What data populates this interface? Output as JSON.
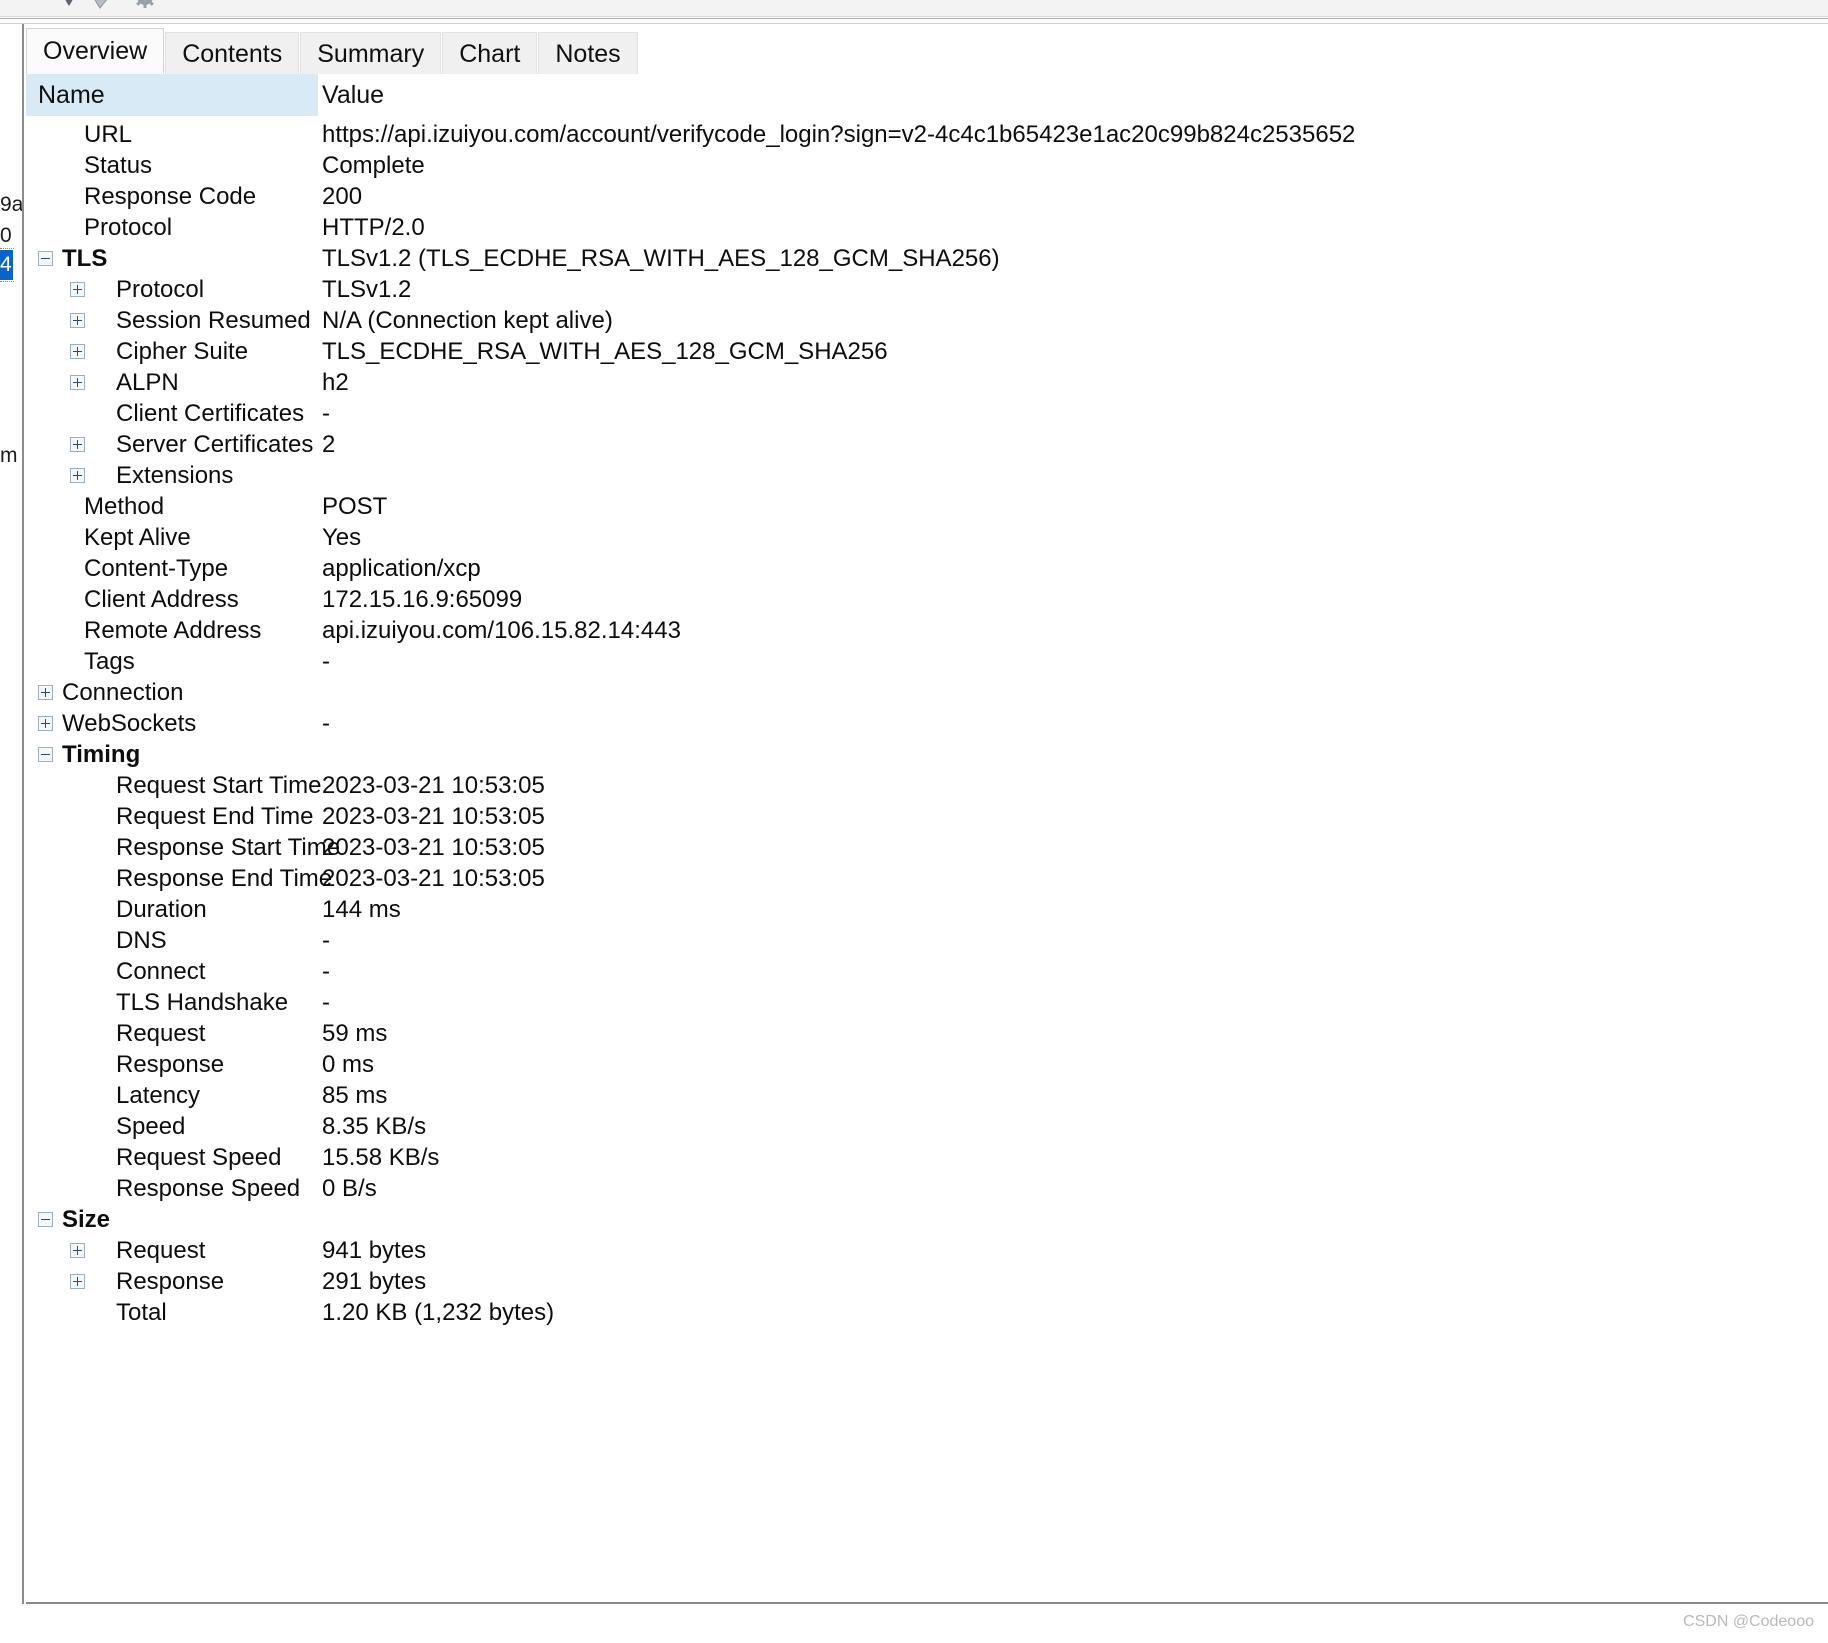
{
  "toolbar": {
    "icons": [
      "pin-icon",
      "tag-icon",
      "gear-icon"
    ]
  },
  "left_gutter": {
    "fragment_1": "9a",
    "fragment_2": "0",
    "selected_fragment": "4",
    "fragment_3": "m"
  },
  "tabs": [
    {
      "label": "Overview",
      "active": true
    },
    {
      "label": "Contents",
      "active": false
    },
    {
      "label": "Summary",
      "active": false
    },
    {
      "label": "Chart",
      "active": false
    },
    {
      "label": "Notes",
      "active": false
    }
  ],
  "grid": {
    "columns": [
      "Name",
      "Value"
    ],
    "rows": [
      {
        "name": "URL",
        "value": "https://api.izuiyou.com/account/verifycode_login?sign=v2-4c4c1b65423e1ac20c99b824c2535652",
        "indent": 1,
        "expander": "none",
        "bold": false
      },
      {
        "name": "Status",
        "value": "Complete",
        "indent": 1,
        "expander": "none",
        "bold": false
      },
      {
        "name": "Response Code",
        "value": "200",
        "indent": 1,
        "expander": "none",
        "bold": false
      },
      {
        "name": "Protocol",
        "value": "HTTP/2.0",
        "indent": 1,
        "expander": "none",
        "bold": false
      },
      {
        "name": "TLS",
        "value": "TLSv1.2 (TLS_ECDHE_RSA_WITH_AES_128_GCM_SHA256)",
        "indent": 0,
        "expander": "minus-l0",
        "bold": true
      },
      {
        "name": "Protocol",
        "value": "TLSv1.2",
        "indent": 2,
        "expander": "plus-l1",
        "bold": false
      },
      {
        "name": "Session Resumed",
        "value": "N/A (Connection kept alive)",
        "indent": 2,
        "expander": "plus-l1",
        "bold": false
      },
      {
        "name": "Cipher Suite",
        "value": "TLS_ECDHE_RSA_WITH_AES_128_GCM_SHA256",
        "indent": 2,
        "expander": "plus-l1",
        "bold": false
      },
      {
        "name": "ALPN",
        "value": "h2",
        "indent": 2,
        "expander": "plus-l1",
        "bold": false
      },
      {
        "name": "Client Certificates",
        "value": "-",
        "indent": 2,
        "expander": "none",
        "bold": false
      },
      {
        "name": "Server Certificates",
        "value": "2",
        "indent": 2,
        "expander": "plus-l1",
        "bold": false
      },
      {
        "name": "Extensions",
        "value": "",
        "indent": 2,
        "expander": "plus-l1",
        "bold": false
      },
      {
        "name": "Method",
        "value": "POST",
        "indent": 1,
        "expander": "none",
        "bold": false
      },
      {
        "name": "Kept Alive",
        "value": "Yes",
        "indent": 1,
        "expander": "none",
        "bold": false
      },
      {
        "name": "Content-Type",
        "value": "application/xcp",
        "indent": 1,
        "expander": "none",
        "bold": false
      },
      {
        "name": "Client Address",
        "value": "172.15.16.9:65099",
        "indent": 1,
        "expander": "none",
        "bold": false
      },
      {
        "name": "Remote Address",
        "value": "api.izuiyou.com/106.15.82.14:443",
        "indent": 1,
        "expander": "none",
        "bold": false
      },
      {
        "name": "Tags",
        "value": "-",
        "indent": 1,
        "expander": "none",
        "bold": false
      },
      {
        "name": "Connection",
        "value": "",
        "indent": 0,
        "expander": "plus-l0",
        "bold": false
      },
      {
        "name": "WebSockets",
        "value": "-",
        "indent": 0,
        "expander": "plus-l0",
        "bold": false
      },
      {
        "name": "Timing",
        "value": "",
        "indent": 0,
        "expander": "minus-l0",
        "bold": true
      },
      {
        "name": "Request Start Time",
        "value": "2023-03-21 10:53:05",
        "indent": 2,
        "expander": "none",
        "bold": false
      },
      {
        "name": "Request End Time",
        "value": "2023-03-21 10:53:05",
        "indent": 2,
        "expander": "none",
        "bold": false
      },
      {
        "name": "Response Start Time",
        "value": "2023-03-21 10:53:05",
        "indent": 2,
        "expander": "none",
        "bold": false
      },
      {
        "name": "Response End Time",
        "value": "2023-03-21 10:53:05",
        "indent": 2,
        "expander": "none",
        "bold": false
      },
      {
        "name": "Duration",
        "value": "144 ms",
        "indent": 2,
        "expander": "none",
        "bold": false
      },
      {
        "name": "DNS",
        "value": "-",
        "indent": 2,
        "expander": "none",
        "bold": false
      },
      {
        "name": "Connect",
        "value": "-",
        "indent": 2,
        "expander": "none",
        "bold": false
      },
      {
        "name": "TLS Handshake",
        "value": "-",
        "indent": 2,
        "expander": "none",
        "bold": false
      },
      {
        "name": "Request",
        "value": "59 ms",
        "indent": 2,
        "expander": "none",
        "bold": false
      },
      {
        "name": "Response",
        "value": "0 ms",
        "indent": 2,
        "expander": "none",
        "bold": false
      },
      {
        "name": "Latency",
        "value": "85 ms",
        "indent": 2,
        "expander": "none",
        "bold": false
      },
      {
        "name": "Speed",
        "value": "8.35 KB/s",
        "indent": 2,
        "expander": "none",
        "bold": false
      },
      {
        "name": "Request Speed",
        "value": "15.58 KB/s",
        "indent": 2,
        "expander": "none",
        "bold": false
      },
      {
        "name": "Response Speed",
        "value": "0 B/s",
        "indent": 2,
        "expander": "none",
        "bold": false
      },
      {
        "name": "Size",
        "value": "",
        "indent": 0,
        "expander": "minus-l0",
        "bold": true
      },
      {
        "name": "Request",
        "value": "941 bytes",
        "indent": 2,
        "expander": "plus-l1",
        "bold": false
      },
      {
        "name": "Response",
        "value": "291 bytes",
        "indent": 2,
        "expander": "plus-l1",
        "bold": false
      },
      {
        "name": "Total",
        "value": "1.20 KB (1,232 bytes)",
        "indent": 2,
        "expander": "none",
        "bold": false
      }
    ]
  },
  "watermark": "CSDN @Codeooo",
  "colors": {
    "header_name_bg": "#d9eaf7",
    "selection_blue": "#0a64c8",
    "expander_border": "#9aaec4",
    "panel_border": "#8c8c8c"
  }
}
